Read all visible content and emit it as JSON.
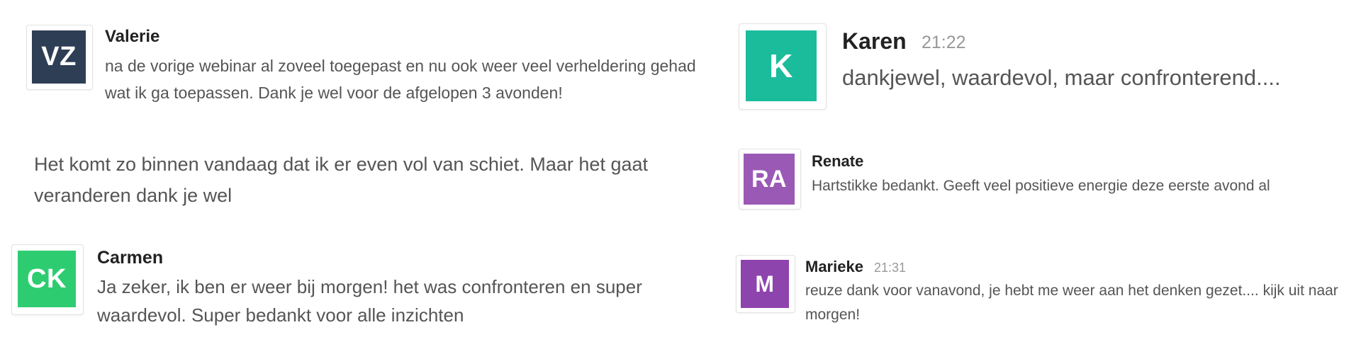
{
  "messages": [
    {
      "initials": "VZ",
      "name": "Valerie",
      "time": "",
      "color": "#2e3e54",
      "text": "na de vorige webinar al zoveel toegepast en nu ook weer veel verheldering gehad wat ik ga toepassen. Dank je wel voor de afgelopen 3 avonden!"
    },
    {
      "initials": "",
      "name": "",
      "time": "",
      "color": "",
      "text": "Het komt zo binnen vandaag dat ik er even vol van schiet. Maar het gaat veranderen dank je wel"
    },
    {
      "initials": "CK",
      "name": "Carmen",
      "time": "",
      "color": "#2ecc71",
      "text": "Ja zeker, ik ben er weer bij morgen! het was confronteren en super waardevol. Super bedankt voor alle inzichten"
    },
    {
      "initials": "K",
      "name": "Karen",
      "time": "21:22",
      "color": "#1abc9c",
      "text": "dankjewel, waardevol, maar confronterend...."
    },
    {
      "initials": "RA",
      "name": "Renate",
      "time": "",
      "color": "#9b59b6",
      "text": "Hartstikke bedankt. Geeft veel positieve energie deze eerste avond al"
    },
    {
      "initials": "M",
      "name": "Marieke",
      "time": "21:31",
      "color": "#8e44ad",
      "text": "reuze dank voor vanavond, je hebt me weer aan het denken gezet.... kijk uit naar morgen!"
    }
  ]
}
